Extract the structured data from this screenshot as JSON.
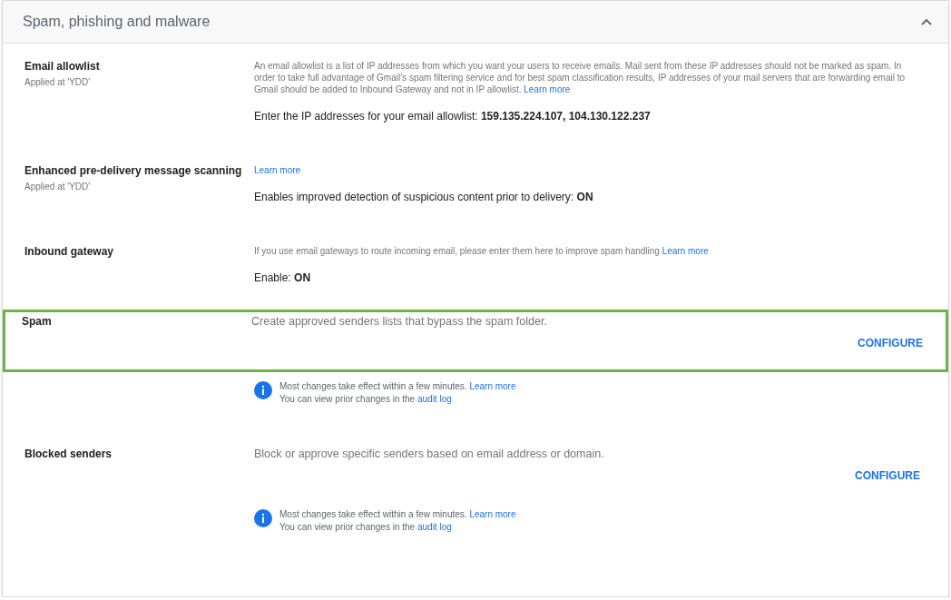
{
  "section": {
    "title": "Spam, phishing and malware",
    "expanded": true
  },
  "settings": [
    {
      "kind": "policy",
      "title": "Email allowlist",
      "applied": "Applied at 'YDD'",
      "description": "An email allowlist is a list of IP addresses from which you want your users to receive emails. Mail sent from these IP addresses should not be marked as spam. In order to take full advantage of Gmail's spam filtering service and for best spam classification results, IP addresses of your mail servers that are forwarding email to Gmail should be added to Inbound Gateway and not in IP allowlist.",
      "link": "Learn more",
      "value_label": "Enter the IP addresses for your email allowlist:",
      "value": "159.135.224.107, 104.130.122.237",
      "highlighted": false
    },
    {
      "kind": "policy",
      "title": "Enhanced pre-delivery message scanning",
      "applied": "Applied at 'YDD'",
      "link": "Learn more",
      "value_label": "Enables improved detection of suspicious content prior to delivery:",
      "value": "ON",
      "highlighted": false
    },
    {
      "kind": "policy",
      "title": "Inbound gateway",
      "description": "If you use email gateways to route incoming email, please enter them here to improve spam handling",
      "link": "Learn more",
      "value_label": "Enable:",
      "value": "ON",
      "highlighted": false
    },
    {
      "kind": "list",
      "title": "Spam",
      "description": "Create approved senders lists that bypass the spam folder.",
      "button": "CONFIGURE",
      "highlighted": true,
      "note": {
        "line1": "Most changes take effect within a few minutes.",
        "link1": "Learn more",
        "line2": "You can view prior changes in the",
        "link2": "audit log"
      }
    },
    {
      "kind": "list",
      "title": "Blocked senders",
      "description": "Block or approve specific senders based on email address or domain.",
      "button": "CONFIGURE",
      "highlighted": false,
      "note": {
        "line1": "Most changes take effect within a few minutes.",
        "link1": "Learn more",
        "line2": "You can view prior changes in the",
        "link2": "audit log"
      }
    }
  ]
}
